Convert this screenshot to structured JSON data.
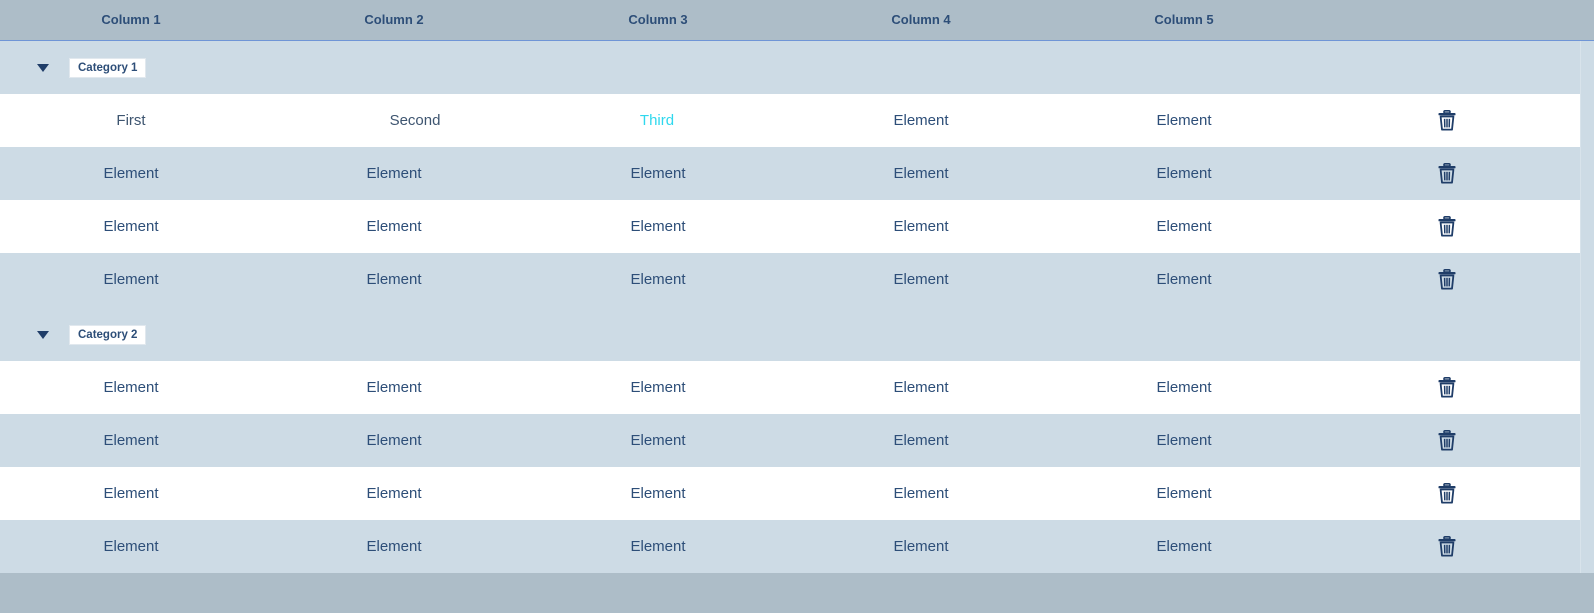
{
  "header": {
    "columns": [
      "Column 1",
      "Column 2",
      "Column 3",
      "Column 4",
      "Column 5"
    ]
  },
  "categories": [
    {
      "label": "Category 1",
      "toggle_icon": "triangle-down-icon",
      "rows": [
        [
          "First",
          "Second",
          "Third",
          "Element",
          "Element"
        ],
        [
          "Element",
          "Element",
          "Element",
          "Element",
          "Element"
        ],
        [
          "Element",
          "Element",
          "Element",
          "Element",
          "Element"
        ],
        [
          "Element",
          "Element",
          "Element",
          "Element",
          "Element"
        ]
      ]
    },
    {
      "label": "Category 2",
      "toggle_icon": "triangle-down-icon",
      "rows": [
        [
          "Element",
          "Element",
          "Element",
          "Element",
          "Element"
        ],
        [
          "Element",
          "Element",
          "Element",
          "Element",
          "Element"
        ],
        [
          "Element",
          "Element",
          "Element",
          "Element",
          "Element"
        ],
        [
          "Element",
          "Element",
          "Element",
          "Element",
          "Element"
        ]
      ]
    }
  ],
  "row_action_icon": "trash-icon",
  "colors": {
    "header_bg": "#adbdc8",
    "row_blue": "#cddbe5",
    "row_white": "#ffffff",
    "text": "#2d4e78",
    "accent": "#2fd8ee"
  }
}
